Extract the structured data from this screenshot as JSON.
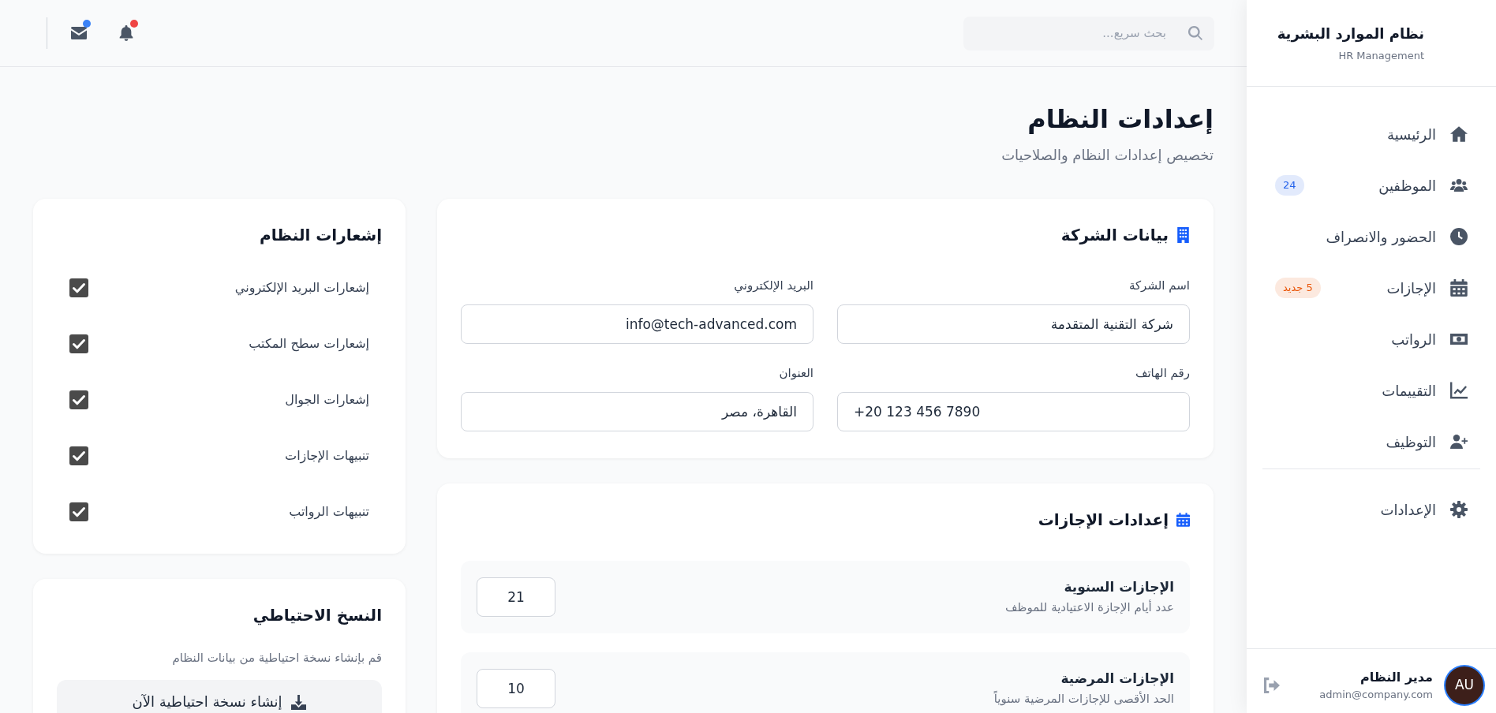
{
  "sidebar": {
    "title": "نظام الموارد البشرية",
    "subtitle": "HR Management",
    "nav_sections": [
      {
        "items": [
          {
            "label": "الرئيسية"
          },
          {
            "label": "الموظفين",
            "badge": {
              "text": "24",
              "color": "#2563eb"
            }
          },
          {
            "label": "الحضور والانصراف"
          },
          {
            "label": "الإجازات",
            "badge": {
              "text": "5 جديد",
              "color": "#ea580c"
            }
          },
          {
            "label": "الرواتب"
          },
          {
            "label": "التقييمات"
          },
          {
            "label": "التوظيف"
          }
        ]
      },
      {
        "items": [
          {
            "label": "الإعدادات"
          }
        ]
      }
    ],
    "user": {
      "initials": "AU",
      "name": "مدير النظام",
      "email": "admin@company.com"
    }
  },
  "top_bar": {
    "search": {
      "placeholder": "بحث سريع..."
    },
    "alerts": [
      {
        "unread": true,
        "color": "#ef4444"
      },
      {
        "unread": true,
        "color": "#3b82f6"
      }
    ]
  },
  "page_header": {
    "title": "إعدادات النظام",
    "subtitle": "تخصيص إعدادات النظام والصلاحيات"
  },
  "company_card": {
    "title": "بيانات الشركة",
    "fields": [
      {
        "label": "اسم الشركة",
        "value": "شركة التقنية المتقدمة",
        "kind": "text"
      },
      {
        "label": "البريد الإلكتروني",
        "value": "info@tech-advanced.com",
        "kind": "email"
      },
      {
        "label": "رقم الهاتف",
        "value": "+20 123 456 7890",
        "kind": "tel"
      },
      {
        "label": "العنوان",
        "value": "القاهرة، مصر",
        "kind": "text"
      }
    ]
  },
  "leave_card": {
    "title": "إعدادات الإجازات",
    "rows": [
      {
        "title": "الإجازات السنوية",
        "description": "عدد أيام الإجازة الاعتيادية للموظف",
        "value": "21"
      },
      {
        "title": "الإجازات المرضية",
        "description": "الحد الأقصى للإجازات المرضية سنوياً",
        "value": "10"
      }
    ]
  },
  "notifications_card": {
    "title": "إشعارات النظام",
    "options": [
      {
        "label": "إشعارات البريد الإلكتروني",
        "checked": true
      },
      {
        "label": "إشعارات سطح المكتب",
        "checked": true
      },
      {
        "label": "إشعارات الجوال",
        "checked": true
      },
      {
        "label": "تنبيهات الإجازات",
        "checked": true
      },
      {
        "label": "تنبيهات الرواتب",
        "checked": true
      }
    ]
  },
  "backup_card": {
    "title": "النسخ الاحتياطي",
    "description": "قم بإنشاء نسخة احتياطية من بيانات النظام",
    "button": "إنشاء نسخة احتياطية الآن"
  }
}
